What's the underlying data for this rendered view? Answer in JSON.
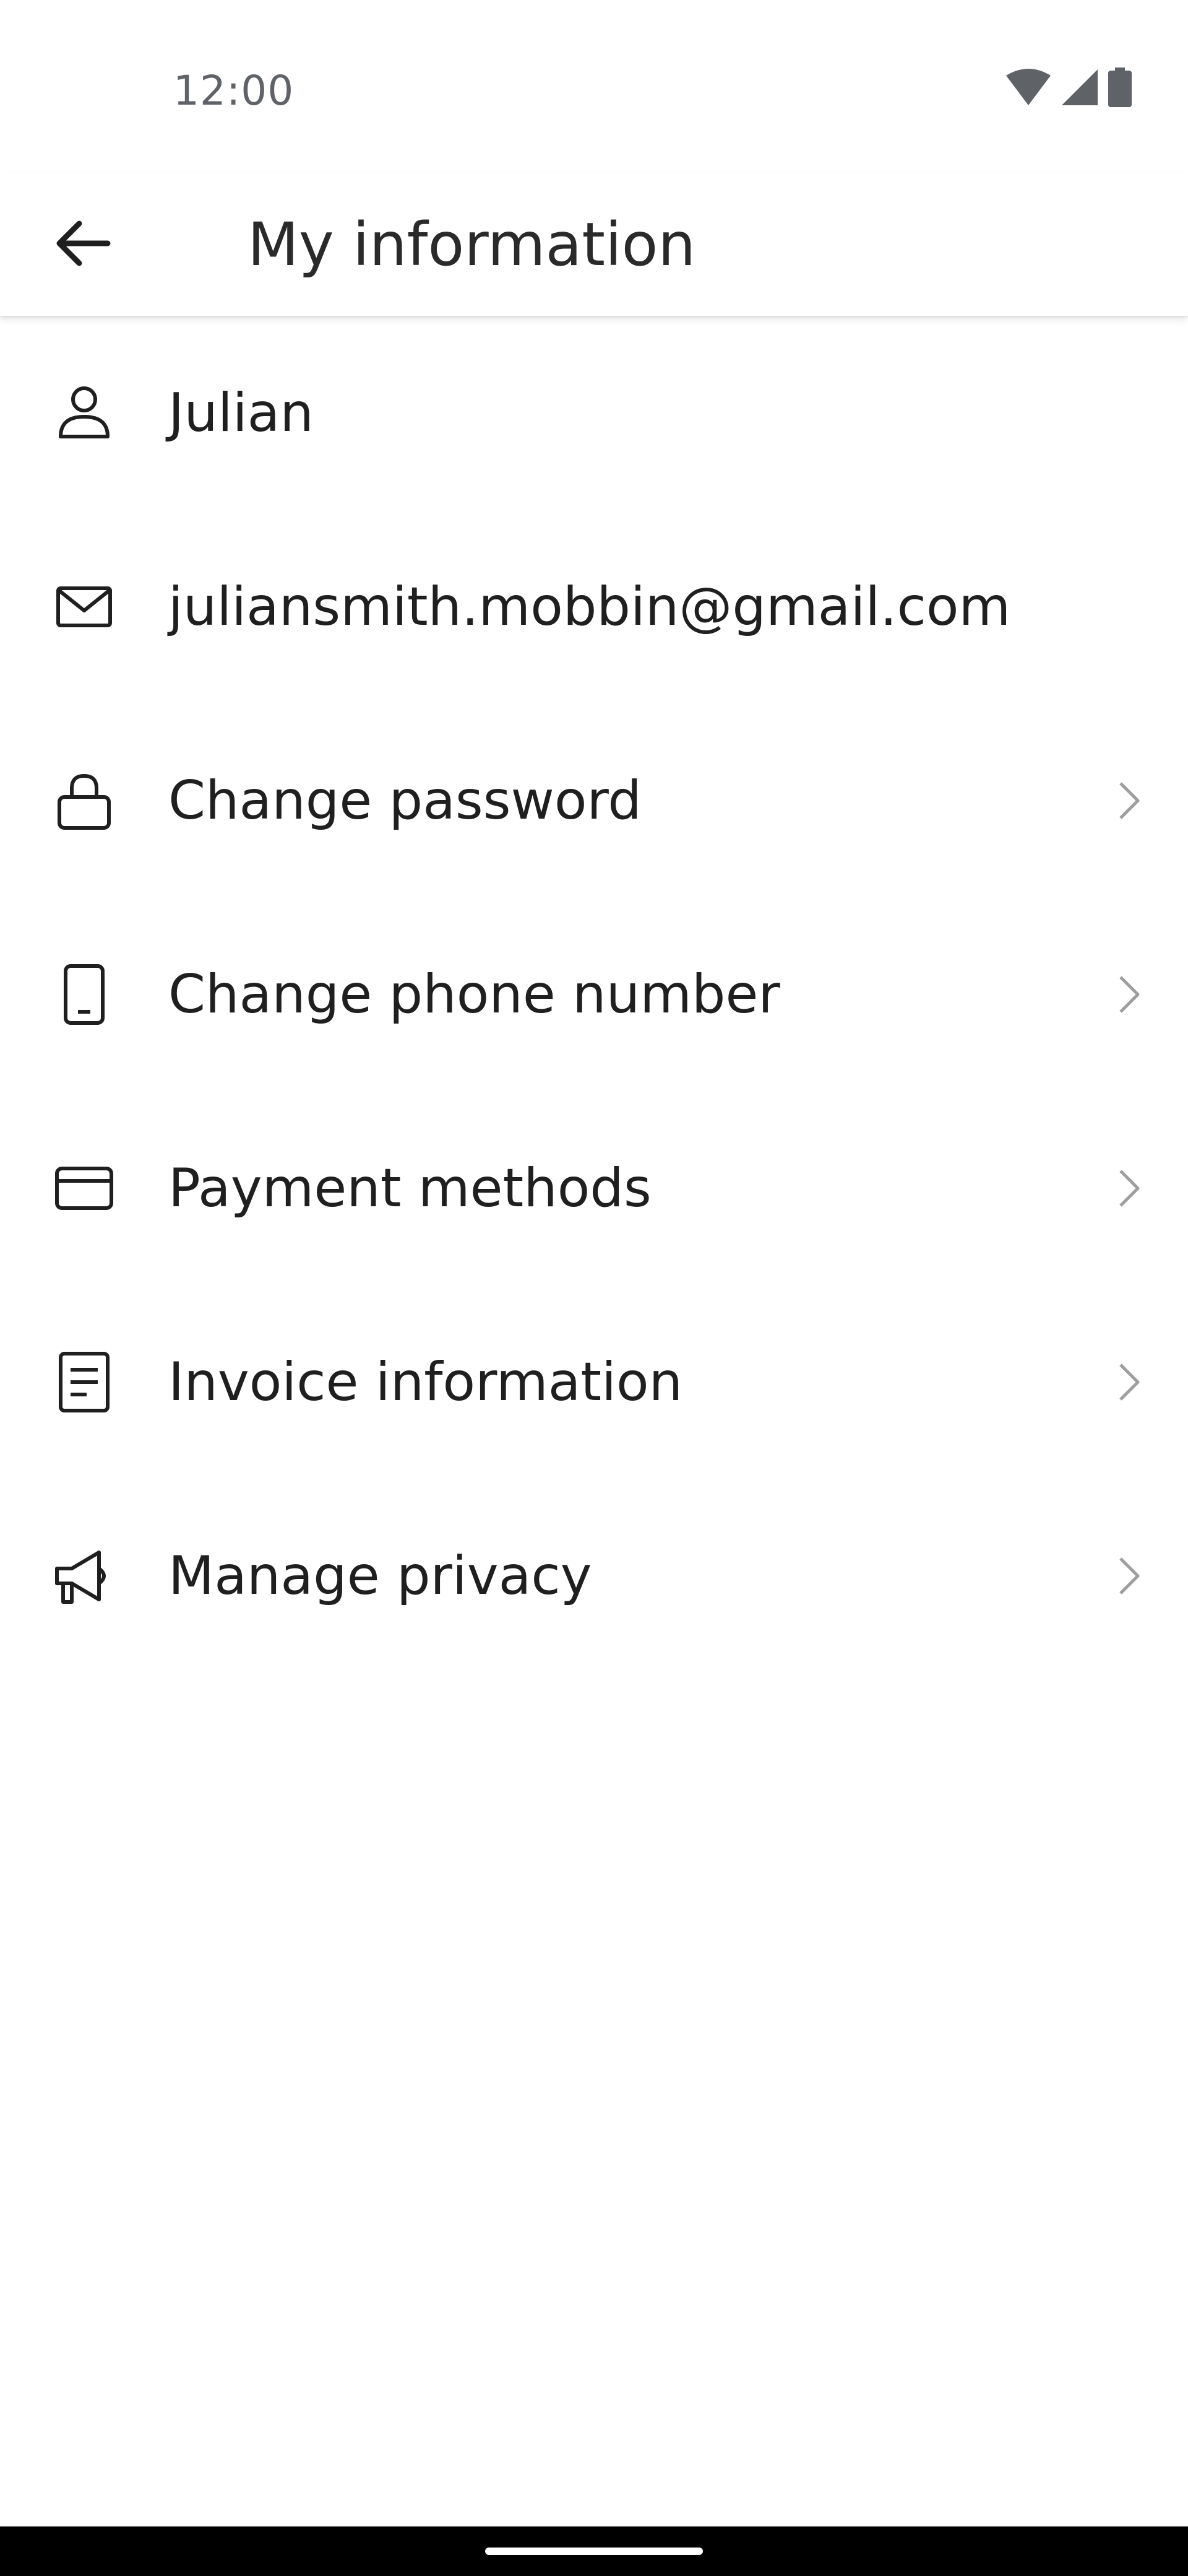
{
  "status_bar": {
    "time": "12:00",
    "icons": [
      "wifi-icon",
      "signal-icon",
      "battery-icon"
    ]
  },
  "app_bar": {
    "title": "My information",
    "back_icon": "arrow-left-icon"
  },
  "items": [
    {
      "icon": "person-icon",
      "label": "Julian",
      "chevron": false
    },
    {
      "icon": "mail-icon",
      "label": "juliansmith.mobbin@gmail.com",
      "chevron": false
    },
    {
      "icon": "lock-icon",
      "label": "Change password",
      "chevron": true
    },
    {
      "icon": "phone-icon",
      "label": "Change phone number",
      "chevron": true
    },
    {
      "icon": "credit-card-icon",
      "label": "Payment methods",
      "chevron": true
    },
    {
      "icon": "document-icon",
      "label": "Invoice information",
      "chevron": true
    },
    {
      "icon": "megaphone-icon",
      "label": "Manage privacy",
      "chevron": true
    }
  ],
  "colors": {
    "text": "#1f1f1f",
    "status_text": "#5f6368",
    "chevron": "#9e9e9e",
    "nav_bar": "#000000"
  }
}
